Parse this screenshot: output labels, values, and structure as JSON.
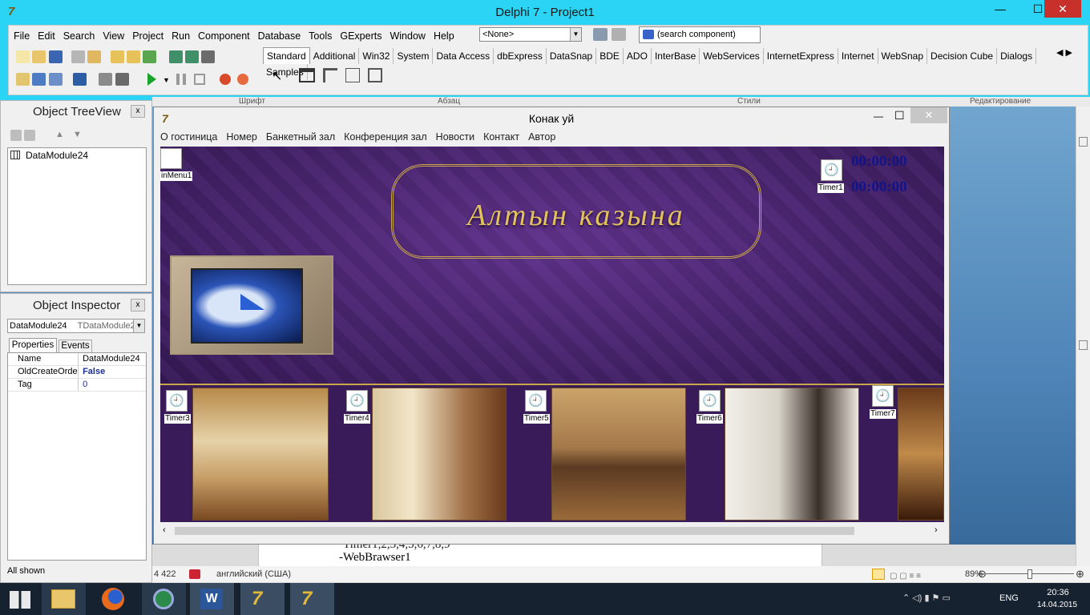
{
  "window": {
    "title": "Delphi 7 - Project1",
    "minimize": "—",
    "maximize": "☐",
    "close": "✕"
  },
  "menu": [
    "File",
    "Edit",
    "Search",
    "View",
    "Project",
    "Run",
    "Component",
    "Database",
    "Tools",
    "GExperts",
    "Window",
    "Help"
  ],
  "toolbar": {
    "combo_value": "<None>",
    "component_search": "(search component)"
  },
  "palette_tabs": [
    "Standard",
    "Additional",
    "Win32",
    "System",
    "Data Access",
    "dbExpress",
    "DataSnap",
    "BDE",
    "ADO",
    "InterBase",
    "WebServices",
    "InternetExpress",
    "Internet",
    "WebSnap",
    "Decision Cube",
    "Dialogs",
    "Samples"
  ],
  "ribbon_groups": [
    "Шрифт",
    "Абзац",
    "Стили",
    "Редактирование"
  ],
  "treeview": {
    "title": "Object TreeView",
    "close": "x",
    "item": "DataModule24",
    "status": "All shown"
  },
  "inspector": {
    "title": "Object Inspector",
    "close": "x",
    "selected_name": "DataModule24",
    "selected_type": "TDataModule24",
    "tabs": [
      "Properties",
      "Events"
    ],
    "rows": [
      {
        "prop": "Name",
        "value": "DataModule24"
      },
      {
        "prop": "OldCreateOrder",
        "value": "False"
      },
      {
        "prop": "Tag",
        "value": "0"
      }
    ]
  },
  "form": {
    "title": "Конак уй",
    "menu": [
      "О гостиница",
      "Номер",
      "Банкетный зал",
      "Конференция зал",
      "Новости",
      "Контакт",
      "Автор"
    ],
    "mainmenu_label": "inMenu1",
    "banner_text": "Алтын казына",
    "clock1": "00:00:00",
    "clock2": "00:00:00",
    "timers": [
      "Timer1",
      "Timer3",
      "Timer4",
      "Timer5",
      "Timer6",
      "Timer7"
    ]
  },
  "word": {
    "line1": "Timer1,2,3,4,5,6,7,8,9",
    "line2": "-WebBrawser1",
    "word_count": "4 422",
    "language": "английский (США)",
    "zoom": "89%"
  },
  "tray": {
    "lang": "ENG",
    "time": "20:36",
    "date": "14.04.2015"
  },
  "colors": {
    "title_accent": "#2bd4f4",
    "close_red": "#c7302b",
    "banner_purple": "#3c1e5e",
    "gold": "#d9b44a"
  }
}
